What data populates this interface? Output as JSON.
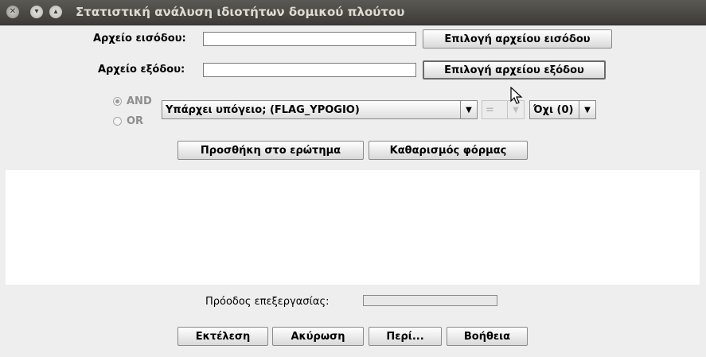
{
  "window": {
    "title": "Στατιστική ανάλυση ιδιοτήτων δομικού πλούτου"
  },
  "input_file": {
    "label": "Αρχείο εισόδου:",
    "value": "",
    "button_label": "Επιλογή αρχείου εισόδου"
  },
  "output_file": {
    "label": "Αρχείο εξόδου:",
    "value": "",
    "button_label": "Επιλογή αρχείου εξόδου"
  },
  "query": {
    "and_label": "AND",
    "or_label": "OR",
    "selected_logic": "AND",
    "field_value": "Υπάρχει υπόγειο; (FLAG_YPOGIO)",
    "operator_value": "=",
    "value_value": "Όχι (0)"
  },
  "buttons": {
    "add_to_query": "Προσθήκη στο ερώτημα",
    "clear_form": "Καθαρισμός φόρμας",
    "execute": "Εκτέλεση",
    "cancel": "Ακύρωση",
    "about": "Περί...",
    "help": "Βοήθεια"
  },
  "progress": {
    "label": "Πρόοδος επεξεργασίας:",
    "value_percent": 0
  }
}
